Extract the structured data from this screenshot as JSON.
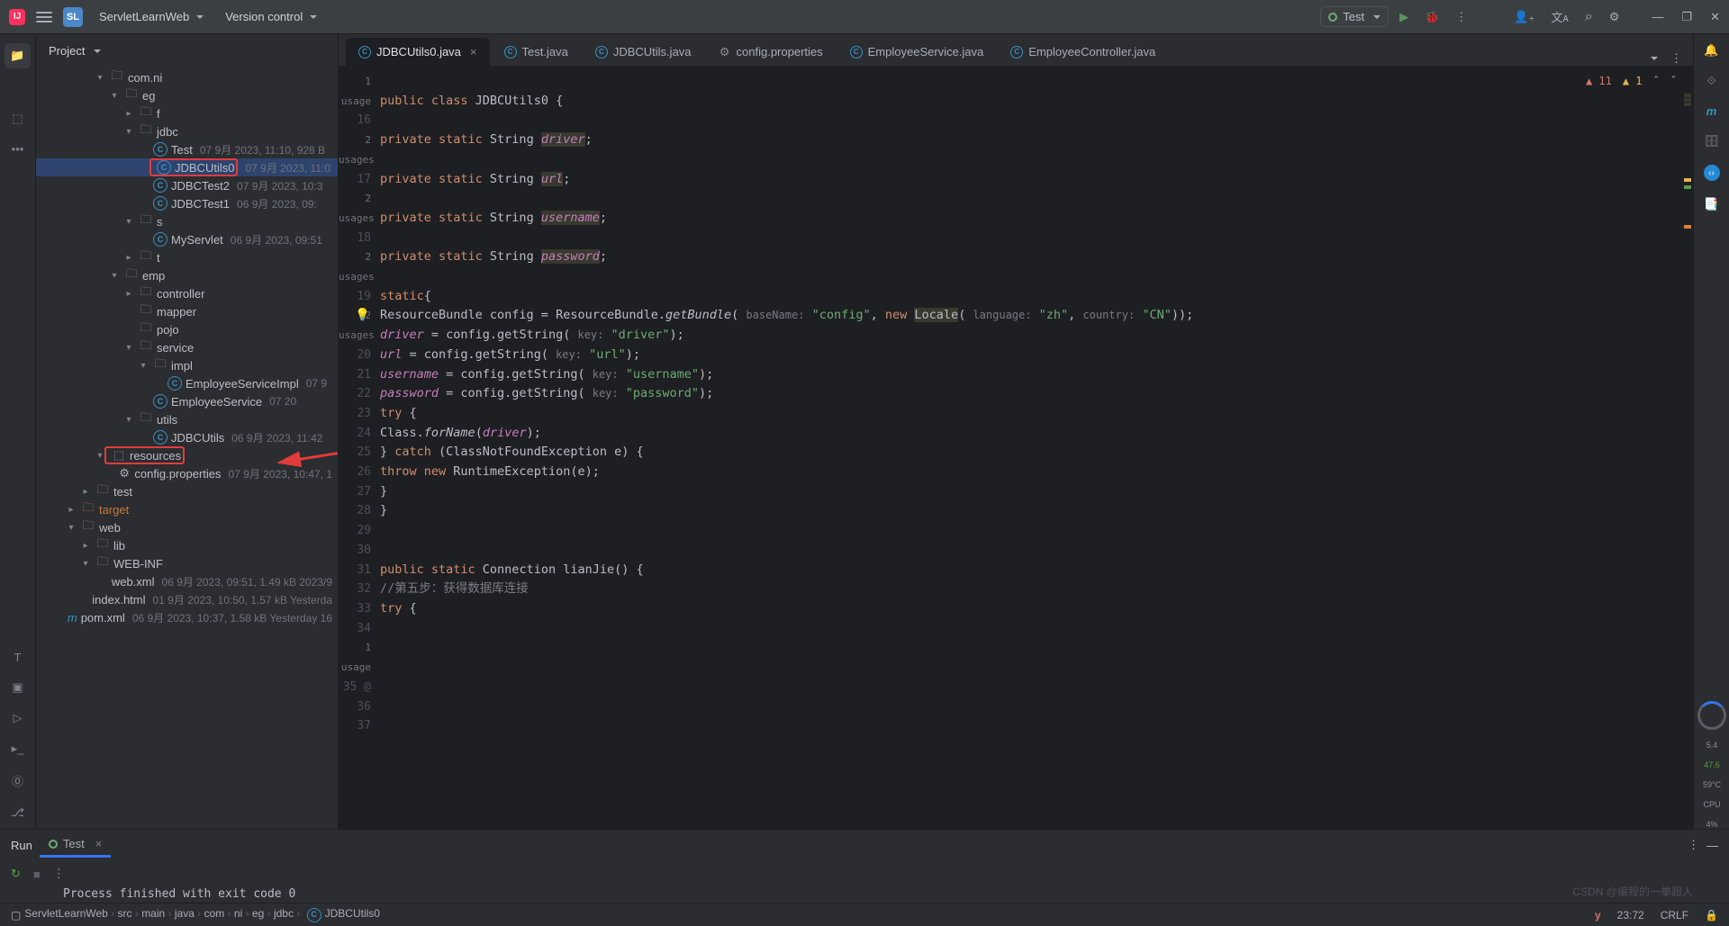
{
  "title_bar": {
    "project_badge": "SL",
    "project_name": "ServletLearnWeb",
    "menu_vc": "Version control",
    "run_config_label": "Test",
    "icons": {
      "run": "▶",
      "debug": "🐞",
      "more": "⋮",
      "addperson": "👤₊",
      "translate": "文ᴀ",
      "search": "⌕",
      "gear": "⚙"
    },
    "win": {
      "min": "—",
      "max": "❐",
      "close": "✕"
    }
  },
  "project_panel": {
    "title": "Project"
  },
  "tree": [
    {
      "d": 4,
      "a": "▾",
      "t": "pkg",
      "n": "com.ni"
    },
    {
      "d": 5,
      "a": "▾",
      "t": "pkg",
      "n": "eg"
    },
    {
      "d": 6,
      "a": "▸",
      "t": "pkg",
      "n": "f"
    },
    {
      "d": 6,
      "a": "▾",
      "t": "pkg",
      "n": "jdbc"
    },
    {
      "d": 7,
      "a": " ",
      "t": "cls",
      "n": "Test",
      "m": "07 9月 2023, 11:10, 928 B"
    },
    {
      "d": 7,
      "a": " ",
      "t": "cls",
      "n": "JDBCUtils0",
      "m": "07 9月 2023, 11:0",
      "sel": true,
      "box": true
    },
    {
      "d": 7,
      "a": " ",
      "t": "cls",
      "n": "JDBCTest2",
      "m": "07 9月 2023, 10:3"
    },
    {
      "d": 7,
      "a": " ",
      "t": "cls",
      "n": "JDBCTest1",
      "m": "06 9月 2023, 09:"
    },
    {
      "d": 6,
      "a": "▾",
      "t": "pkg",
      "n": "s"
    },
    {
      "d": 7,
      "a": " ",
      "t": "cls",
      "n": "MyServlet",
      "m": "06 9月 2023, 09:51"
    },
    {
      "d": 6,
      "a": "▸",
      "t": "pkg",
      "n": "t"
    },
    {
      "d": 5,
      "a": "▾",
      "t": "pkg",
      "n": "emp"
    },
    {
      "d": 6,
      "a": "▸",
      "t": "pkg",
      "n": "controller"
    },
    {
      "d": 6,
      "a": " ",
      "t": "pkg",
      "n": "mapper"
    },
    {
      "d": 6,
      "a": " ",
      "t": "pkg",
      "n": "pojo"
    },
    {
      "d": 6,
      "a": "▾",
      "t": "pkg",
      "n": "service"
    },
    {
      "d": 7,
      "a": "▾",
      "t": "pkg",
      "n": "impl"
    },
    {
      "d": 8,
      "a": " ",
      "t": "cls",
      "n": "EmployeeServiceImpl",
      "m": "07 9"
    },
    {
      "d": 7,
      "a": " ",
      "t": "cls",
      "n": "EmployeeService",
      "m": "07 20"
    },
    {
      "d": 6,
      "a": "▾",
      "t": "pkg",
      "n": "utils"
    },
    {
      "d": 7,
      "a": " ",
      "t": "cls",
      "n": "JDBCUtils",
      "m": "06 9月 2023, 11:42"
    },
    {
      "d": 4,
      "a": "▾",
      "t": "res",
      "n": "resources",
      "box": true,
      "boxRow": true
    },
    {
      "d": 5,
      "a": " ",
      "t": "gear",
      "n": "config.properties",
      "m": "07 9月 2023, 10:47, 1"
    },
    {
      "d": 3,
      "a": "▸",
      "t": "dir",
      "n": "test"
    },
    {
      "d": 2,
      "a": "▸",
      "t": "tgt",
      "n": "target",
      "tgt": true
    },
    {
      "d": 2,
      "a": "▾",
      "t": "dir",
      "n": "web"
    },
    {
      "d": 3,
      "a": "▸",
      "t": "dir",
      "n": "lib"
    },
    {
      "d": 3,
      "a": "▾",
      "t": "dir",
      "n": "WEB-INF"
    },
    {
      "d": 4,
      "a": " ",
      "t": "xml",
      "n": "web.xml",
      "m": "06 9月 2023, 09:51, 1.49 kB  2023/9"
    },
    {
      "d": 3,
      "a": " ",
      "t": "xml",
      "n": "index.html",
      "m": "01 9月 2023, 10:50, 1.57 kB  Yesterda"
    },
    {
      "d": 2,
      "a": " ",
      "t": "mvn",
      "n": "pom.xml",
      "m": "06 9月 2023, 10:37, 1.58 kB  Yesterday 16"
    }
  ],
  "tabs": [
    {
      "t": "java",
      "label": "JDBCUtils0.java",
      "active": true,
      "close": true
    },
    {
      "t": "java",
      "label": "Test.java"
    },
    {
      "t": "java",
      "label": "JDBCUtils.java"
    },
    {
      "t": "prop",
      "label": "config.properties",
      "ic": "⚙"
    },
    {
      "t": "java",
      "label": "EmployeeService.java"
    },
    {
      "t": "java",
      "label": "EmployeeController.java"
    }
  ],
  "warnings": {
    "err_ct": "11",
    "warn_ct": "1"
  },
  "code": {
    "u": "usage",
    "u2": "usages",
    "l16": "public class JDBCUtils0 {",
    "l17f": "driver",
    "l18f": "url",
    "l19f": "username",
    "l20f": "password",
    "privStaticStr": "private static String ",
    "staticOpen": "static{",
    "l23a": "ResourceBundle config = ResourceBundle.",
    "l23b": "getBundle",
    "l23c": "( ",
    "l23h1": "baseName:",
    "l23s1": "\"config\"",
    "l23d": ", ",
    "l23kw": "new",
    "l23e": " Locale( ",
    "l23h2": "language:",
    "l23s2": "\"zh\"",
    "l23f": ",   ",
    "l23h3": "country:",
    "l23s3": "\"CN\"",
    "l23g": "));",
    "l24": "driver = config.getString( ",
    "l24k": "key:",
    "l24s": "\"driver\"",
    "l24e": ");",
    "l25": "url = config.getString( ",
    "l25k": "key:",
    "l25s": "\"url\"",
    "l25e": ");",
    "l26": "username = config.getString( ",
    "l26k": "key:",
    "l26s": "\"username\"",
    "l26e": ");",
    "l27": "password = config.getString( ",
    "l27k": "key:",
    "l27s": "\"password\"",
    "l27e": ");",
    "try": "try {",
    "l29": "Class.",
    "l29b": "forName",
    "l29c": "(",
    "l29d": "driver",
    "l29e": ");",
    "catch": "} catch (ClassNotFoundException e) {",
    "throw": "throw new RuntimeException(e);",
    "close": "}",
    "l35": "public static Connection lianJie() {",
    "l36": "//第五步：获得数据库连接",
    "lnums": [
      "16",
      "17",
      "18",
      "19",
      "20",
      "21",
      "22",
      "23",
      "24",
      "25",
      "26",
      "27",
      "28",
      "29",
      "30",
      "31",
      "32",
      "33",
      "34",
      "35",
      "36",
      "37"
    ]
  },
  "run": {
    "tab_run": "Run",
    "tab_cfg": "Test",
    "out": "Process finished with exit code 0"
  },
  "breadcrumb": [
    "ServletLearnWeb",
    "src",
    "main",
    "java",
    "com",
    "ni",
    "eg",
    "jdbc",
    "JDBCUtils0"
  ],
  "status": {
    "pos": "23:72",
    "enc": "CRLF",
    "y": "y",
    "lock": "🔒"
  },
  "perf": {
    "k": "5.4",
    "kb": "47.6",
    "c": "59°C",
    "cpu": "CPU",
    "pct": "4%"
  },
  "watermark": "CSDN @编程的一拳超人"
}
